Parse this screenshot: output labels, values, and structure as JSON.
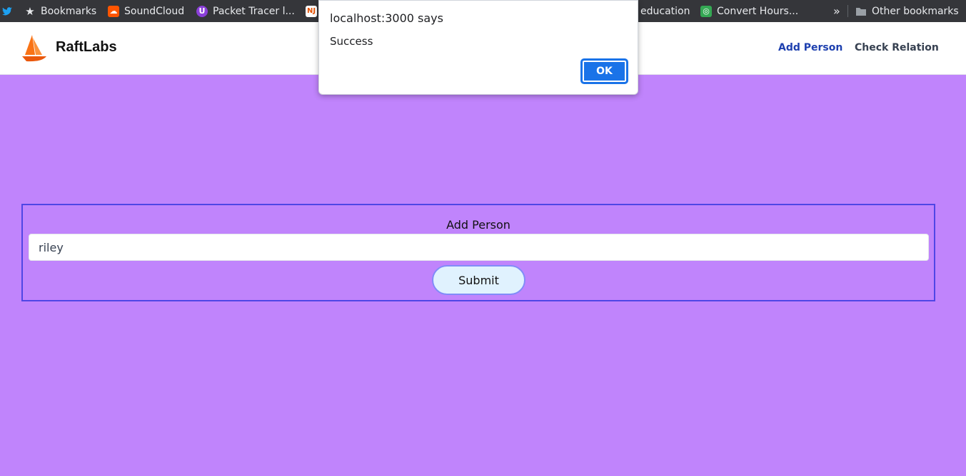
{
  "bookmarks": {
    "items": [
      {
        "label": "Bookmarks",
        "icon": "star-icon"
      },
      {
        "label": "SoundCloud",
        "icon": "soundcloud-icon"
      },
      {
        "label": "Packet Tracer l...",
        "icon": "packet-tracer-icon"
      },
      {
        "label": "NJ",
        "icon": "nj-icon"
      },
      {
        "label": "education",
        "icon": ""
      },
      {
        "label": "Convert Hours...",
        "icon": "convert-icon"
      }
    ],
    "overflow_label": "»",
    "other_label": "Other bookmarks"
  },
  "header": {
    "brand": "RaftLabs",
    "nav": {
      "add_person": "Add Person",
      "check_relation": "Check Relation"
    },
    "accent_color": "#1e40af",
    "logo_color": "#f97316"
  },
  "form": {
    "title": "Add Person",
    "input_value": "riley",
    "submit_label": "Submit",
    "background_color": "#c084fc"
  },
  "dialog": {
    "title": "localhost:3000 says",
    "message": "Success",
    "ok_label": "OK"
  }
}
